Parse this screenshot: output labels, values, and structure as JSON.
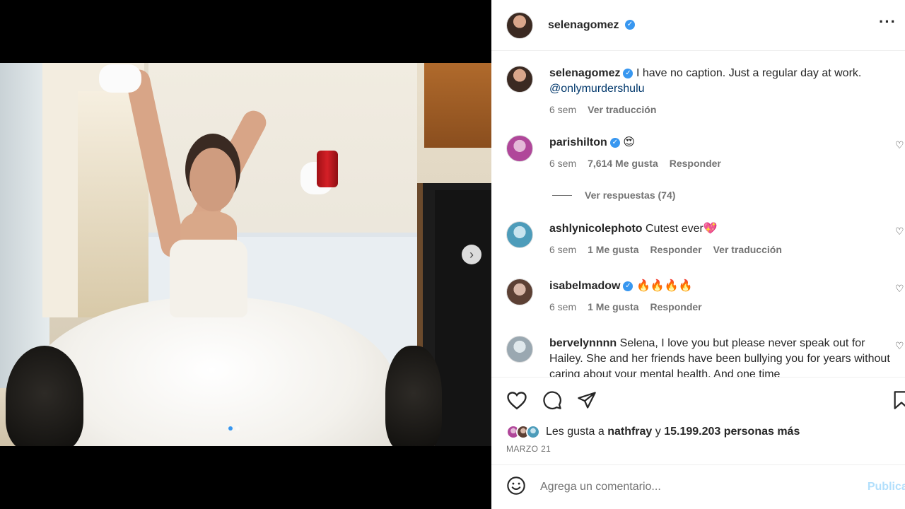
{
  "post": {
    "author": "selenagomez",
    "caption": "I have no caption. Just a regular day at work.",
    "mention": "@onlymurdershulu",
    "time": "6 sem",
    "translate": "Ver traducción"
  },
  "comments": [
    {
      "user": "parishilton",
      "verified": true,
      "text": "😍",
      "time": "6 sem",
      "likes": "7,614 Me gusta",
      "reply": "Responder"
    },
    {
      "user": "ashlynicolephoto",
      "verified": false,
      "text": "Cutest ever💖",
      "time": "6 sem",
      "likes": "1 Me gusta",
      "reply": "Responder",
      "translate": "Ver traducción"
    },
    {
      "user": "isabelmadow",
      "verified": true,
      "text": "🔥🔥🔥🔥",
      "time": "6 sem",
      "likes": "1 Me gusta",
      "reply": "Responder"
    },
    {
      "user": "bervelynnnn",
      "verified": false,
      "text": "Selena, I love you but please never speak out for Hailey. She and her friends have been bullying you for years without caring about your mental health. And one time"
    }
  ],
  "view_replies": "Ver respuestas (74)",
  "likes_summary": {
    "prefix": "Les gusta a",
    "user": "nathfray",
    "connector": "y",
    "count": "15.199.203 personas más"
  },
  "date": "MARZO 21",
  "add_comment": {
    "placeholder": "Agrega un comentario...",
    "publish": "Publicar"
  },
  "icons": {
    "verified": "verified-badge-icon",
    "more": "more-options-icon",
    "like": "heart-icon",
    "comment": "comment-icon",
    "share": "paper-plane-icon",
    "save": "bookmark-icon",
    "emoji": "emoji-icon",
    "next": "chevron-right-icon"
  },
  "colors": {
    "accent": "#3897f0",
    "link": "#00376b",
    "secondary_text": "#737373",
    "publish_disabled": "#b2dffc"
  }
}
